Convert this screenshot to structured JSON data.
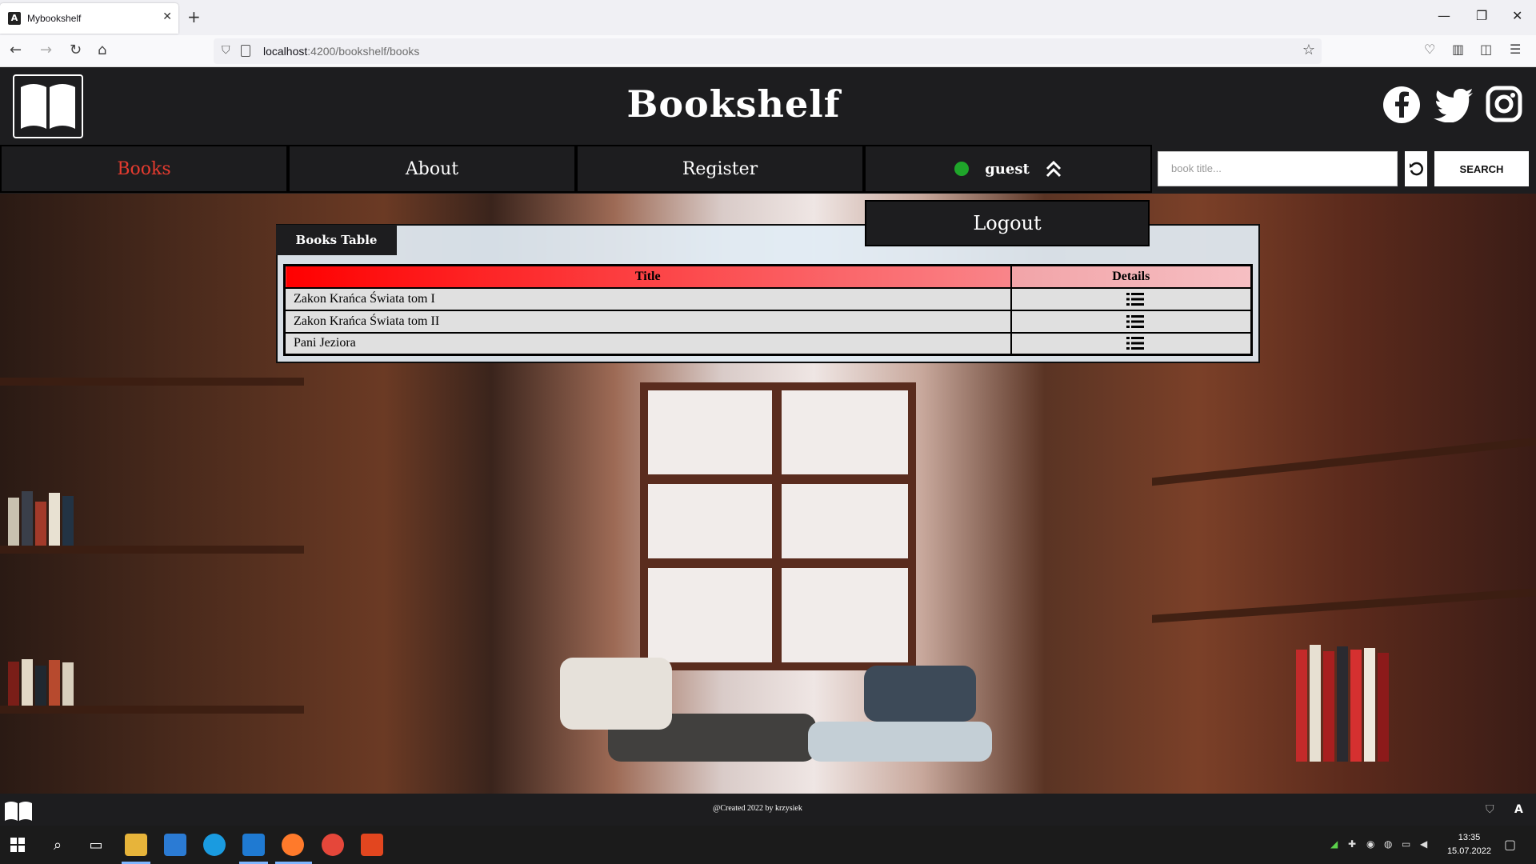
{
  "browser": {
    "tab_title": "Mybookshelf",
    "url_host": "localhost",
    "url_path": ":4200/bookshelf/books"
  },
  "app": {
    "title": "Bookshelf",
    "menu": {
      "books": "Books",
      "about": "About",
      "register": "Register",
      "user": "guest"
    },
    "search": {
      "placeholder": "book title...",
      "button": "SEARCH"
    },
    "dropdown": {
      "logout": "Logout"
    },
    "books_table": {
      "tab_label": "Books Table",
      "columns": [
        "Title",
        "Details"
      ],
      "rows": [
        {
          "title": "Zakon Krańca Świata tom I"
        },
        {
          "title": "Zakon Krańca Świata tom II"
        },
        {
          "title": "Pani Jeziora"
        }
      ]
    },
    "footer": "@Created 2022 by krzysiek"
  },
  "taskbar": {
    "time": "13:35",
    "date": "15.07.2022"
  },
  "colors": {
    "active_menu": "#e53b2f",
    "title_header_start": "#ff0000",
    "user_status": "#1fa52a"
  }
}
